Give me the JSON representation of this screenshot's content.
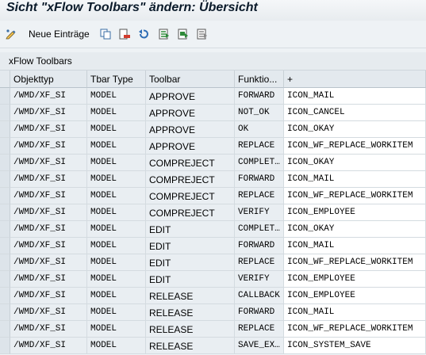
{
  "title": "Sicht \"xFlow Toolbars\" ändern: Übersicht",
  "toolbar": {
    "new_entries_label": "Neue Einträge",
    "icons": [
      "edit-toggle-icon",
      "copy-icon",
      "delete-icon",
      "undo-icon",
      "select-all-icon",
      "select-block-icon",
      "deselect-all-icon"
    ]
  },
  "panel": {
    "title": "xFlow Toolbars"
  },
  "table": {
    "headers": [
      "Objekttyp",
      "Tbar Type",
      "Toolbar",
      "Funktio...",
      "+"
    ],
    "rows": [
      [
        "/WMD/XF_SI",
        "MODEL",
        "APPROVE",
        "FORWARD",
        "ICON_MAIL"
      ],
      [
        "/WMD/XF_SI",
        "MODEL",
        "APPROVE",
        "NOT_OK",
        "ICON_CANCEL"
      ],
      [
        "/WMD/XF_SI",
        "MODEL",
        "APPROVE",
        "OK",
        "ICON_OKAY"
      ],
      [
        "/WMD/XF_SI",
        "MODEL",
        "APPROVE",
        "REPLACE",
        "ICON_WF_REPLACE_WORKITEM"
      ],
      [
        "/WMD/XF_SI",
        "MODEL",
        "COMPREJECT",
        "COMPLET…",
        "ICON_OKAY"
      ],
      [
        "/WMD/XF_SI",
        "MODEL",
        "COMPREJECT",
        "FORWARD",
        "ICON_MAIL"
      ],
      [
        "/WMD/XF_SI",
        "MODEL",
        "COMPREJECT",
        "REPLACE",
        "ICON_WF_REPLACE_WORKITEM"
      ],
      [
        "/WMD/XF_SI",
        "MODEL",
        "COMPREJECT",
        "VERIFY",
        "ICON_EMPLOYEE"
      ],
      [
        "/WMD/XF_SI",
        "MODEL",
        "EDIT",
        "COMPLET…",
        "ICON_OKAY"
      ],
      [
        "/WMD/XF_SI",
        "MODEL",
        "EDIT",
        "FORWARD",
        "ICON_MAIL"
      ],
      [
        "/WMD/XF_SI",
        "MODEL",
        "EDIT",
        "REPLACE",
        "ICON_WF_REPLACE_WORKITEM"
      ],
      [
        "/WMD/XF_SI",
        "MODEL",
        "EDIT",
        "VERIFY",
        "ICON_EMPLOYEE"
      ],
      [
        "/WMD/XF_SI",
        "MODEL",
        "RELEASE",
        "CALLBACK",
        "ICON_EMPLOYEE"
      ],
      [
        "/WMD/XF_SI",
        "MODEL",
        "RELEASE",
        "FORWARD",
        "ICON_MAIL"
      ],
      [
        "/WMD/XF_SI",
        "MODEL",
        "RELEASE",
        "REPLACE",
        "ICON_WF_REPLACE_WORKITEM"
      ],
      [
        "/WMD/XF_SI",
        "MODEL",
        "RELEASE",
        "SAVE_EX…",
        "ICON_SYSTEM_SAVE"
      ]
    ]
  }
}
